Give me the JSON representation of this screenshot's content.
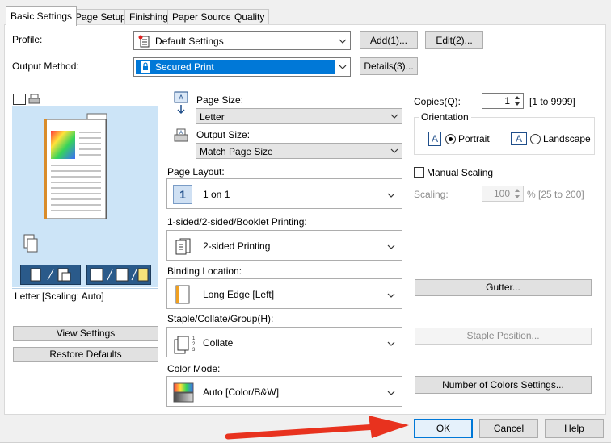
{
  "tabs": [
    {
      "label": "Basic Settings",
      "active": true
    },
    {
      "label": "Page Setup",
      "active": false
    },
    {
      "label": "Finishing",
      "active": false
    },
    {
      "label": "Paper Source",
      "active": false
    },
    {
      "label": "Quality",
      "active": false
    }
  ],
  "profile": {
    "label": "Profile:",
    "value": "Default Settings",
    "add_label": "Add(1)...",
    "edit_label": "Edit(2)..."
  },
  "output_method": {
    "label": "Output Method:",
    "value": "Secured Print",
    "details_label": "Details(3)..."
  },
  "preview": {
    "status_text": "Letter [Scaling: Auto]"
  },
  "left_buttons": {
    "view_settings": "View Settings",
    "restore_defaults": "Restore Defaults"
  },
  "page_size": {
    "label": "Page Size:",
    "value": "Letter"
  },
  "output_size": {
    "label": "Output Size:",
    "value": "Match Page Size"
  },
  "page_layout": {
    "label": "Page Layout:",
    "value": "1 on 1",
    "icon_text": "1"
  },
  "sided": {
    "label": "1-sided/2-sided/Booklet Printing:",
    "value": "2-sided Printing"
  },
  "binding": {
    "label": "Binding Location:",
    "value": "Long Edge [Left]"
  },
  "staple": {
    "label": "Staple/Collate/Group(H):",
    "value": "Collate"
  },
  "color_mode": {
    "label": "Color Mode:",
    "value": "Auto [Color/B&W]"
  },
  "copies": {
    "label": "Copies(Q):",
    "value": "1",
    "range": "[1 to 9999]"
  },
  "orientation": {
    "title": "Orientation",
    "portrait": "Portrait",
    "landscape": "Landscape",
    "selected": "portrait",
    "icon_letter": "A"
  },
  "manual_scaling": {
    "label": "Manual Scaling",
    "checked": false,
    "scaling_label": "Scaling:",
    "scaling_value": "100",
    "scaling_range": "% [25 to 200]"
  },
  "right_buttons": {
    "gutter": "Gutter...",
    "staple_position": "Staple Position...",
    "number_of_colors": "Number of Colors Settings..."
  },
  "dialog_buttons": {
    "ok": "OK",
    "cancel": "Cancel",
    "help": "Help"
  },
  "colors": {
    "selection_blue": "#0078d7",
    "preview_bg": "#cce4f7",
    "annotation_arrow": "#e8321e"
  },
  "icons": {
    "profile": "profile-document-icon",
    "output_method": "secured-print-lock-icon",
    "page_size": "page-size-icon",
    "output_size": "output-size-printer-icon",
    "annotation": "red-arrow-pointing-ok"
  }
}
